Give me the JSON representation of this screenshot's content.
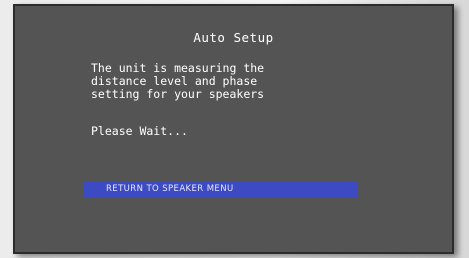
{
  "screen": {
    "title": "Auto Setup",
    "message_lines": [
      "The unit is measuring the",
      "distance level and phase",
      "setting for your speakers"
    ],
    "status": "Please Wait...",
    "return_button_label": "RETURN TO SPEAKER MENU"
  },
  "colors": {
    "screen_background": "#555454",
    "highlight_bar": "#3d4bc2",
    "text": "#ffffff"
  }
}
